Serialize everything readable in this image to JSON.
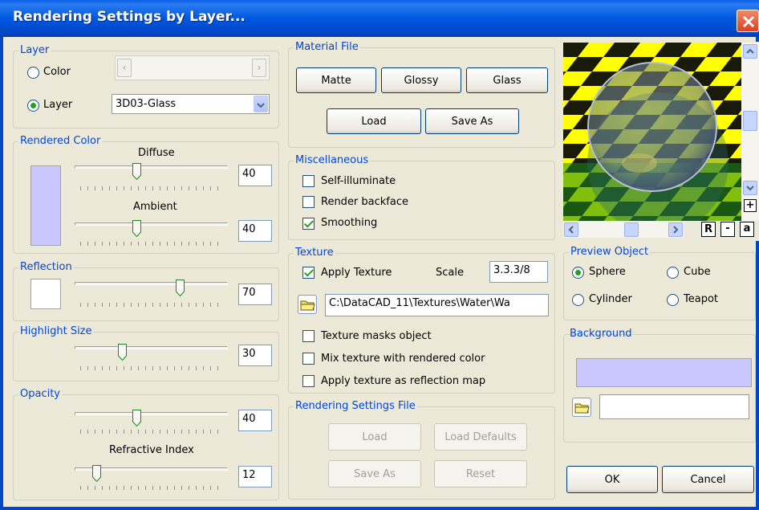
{
  "window": {
    "title": "Rendering Settings by Layer..."
  },
  "layer": {
    "legend": "Layer",
    "color_label": "Color",
    "layer_label": "Layer",
    "selected": "Layer",
    "layer_value": "3D03-Glass"
  },
  "rendered_color": {
    "legend": "Rendered Color",
    "diffuse_label": "Diffuse",
    "diffuse_value": "40",
    "ambient_label": "Ambient",
    "ambient_value": "40",
    "swatch_color": "#c8c8ff"
  },
  "reflection": {
    "legend": "Reflection",
    "value": "70",
    "swatch_color": "#ffffff"
  },
  "highlight": {
    "legend": "Highlight Size",
    "value": "30"
  },
  "opacity": {
    "legend": "Opacity",
    "value": "40",
    "refractive_label": "Refractive Index",
    "refractive_value": "12"
  },
  "material_file": {
    "legend": "Material File",
    "matte": "Matte",
    "glossy": "Glossy",
    "glass": "Glass",
    "load": "Load",
    "save_as": "Save As"
  },
  "misc": {
    "legend": "Miscellaneous",
    "self_illuminate": "Self-illuminate",
    "render_backface": "Render backface",
    "smoothing": "Smoothing",
    "checked": {
      "self_illuminate": false,
      "render_backface": false,
      "smoothing": true
    }
  },
  "texture": {
    "legend": "Texture",
    "apply_label": "Apply Texture",
    "apply_checked": true,
    "scale_label": "Scale",
    "scale_value": "3.3.3/8",
    "path": "C:\\DataCAD_11\\Textures\\Water\\Wa",
    "masks_label": "Texture masks object",
    "mix_label": "Mix texture with rendered color",
    "reflection_map_label": "Apply texture as reflection map"
  },
  "rendering_file": {
    "legend": "Rendering Settings File",
    "load": "Load",
    "load_defaults": "Load Defaults",
    "save_as": "Save As",
    "reset": "Reset"
  },
  "preview": {
    "button_r": "R",
    "button_minus": "-",
    "button_a": "a"
  },
  "preview_object": {
    "legend": "Preview Object",
    "sphere": "Sphere",
    "cube": "Cube",
    "cylinder": "Cylinder",
    "teapot": "Teapot",
    "selected": "Sphere"
  },
  "background": {
    "legend": "Background",
    "color": "#c8c8ff",
    "path": ""
  },
  "buttons": {
    "ok": "OK",
    "cancel": "Cancel"
  },
  "sliders": {
    "diffuse": 0.4,
    "ambient": 0.4,
    "reflection": 0.7,
    "highlight": 0.3,
    "opacity": 0.4,
    "refractive": 0.12
  },
  "colors": {
    "accent": "#0046d5",
    "title_bar": "#0058e0",
    "checker_yellow": "#ffff00",
    "checker_green": "#1a8a1a"
  }
}
